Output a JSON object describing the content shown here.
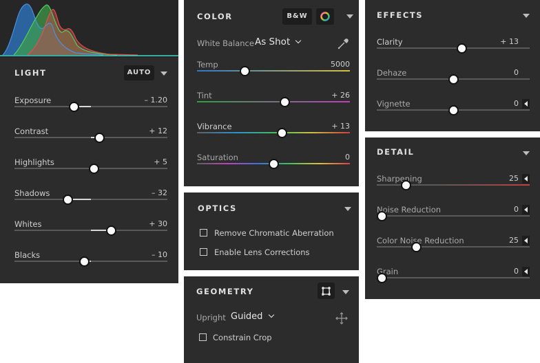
{
  "light": {
    "title": "LIGHT",
    "auto_label": "AUTO",
    "sliders": [
      {
        "label": "Exposure",
        "value": "– 1.20",
        "position": 0.39
      },
      {
        "label": "Contrast",
        "value": "+ 12",
        "position": 0.555
      },
      {
        "label": "Highlights",
        "value": "+ 5",
        "position": 0.52
      },
      {
        "label": "Shadows",
        "value": "– 32",
        "position": 0.35
      },
      {
        "label": "Whites",
        "value": "+ 30",
        "position": 0.635
      },
      {
        "label": "Blacks",
        "value": "– 10",
        "position": 0.455
      }
    ]
  },
  "color": {
    "title": "COLOR",
    "bw_label": "B&W",
    "white_balance_label": "White Balance",
    "white_balance_value": "As Shot",
    "sliders": [
      {
        "label": "Temp",
        "value": "5000",
        "position": 0.315
      },
      {
        "label": "Tint",
        "value": "+ 26",
        "position": 0.575
      },
      {
        "label": "Vibrance",
        "value": "+ 13",
        "position": 0.555
      },
      {
        "label": "Saturation",
        "value": "0",
        "position": 0.5
      }
    ]
  },
  "optics": {
    "title": "OPTICS",
    "checkboxes": [
      "Remove Chromatic Aberration",
      "Enable Lens Corrections"
    ]
  },
  "geometry": {
    "title": "GEOMETRY",
    "upright_label": "Upright",
    "upright_value": "Guided",
    "constrain_label": "Constrain Crop"
  },
  "effects": {
    "title": "EFFECTS",
    "sliders": [
      {
        "label": "Clarity",
        "value": "+ 13",
        "position": 0.555
      },
      {
        "label": "Dehaze",
        "value": "0",
        "position": 0.5
      },
      {
        "label": "Vignette",
        "value": "0",
        "position": 0.5
      }
    ]
  },
  "detail": {
    "title": "DETAIL",
    "sliders": [
      {
        "label": "Sharpening",
        "value": "25",
        "position": 0.19
      },
      {
        "label": "Noise Reduction",
        "value": "0",
        "position": 0.0
      },
      {
        "label": "Color Noise Reduction",
        "value": "25",
        "position": 0.26
      },
      {
        "label": "Grain",
        "value": "0",
        "position": 0.0
      }
    ]
  }
}
